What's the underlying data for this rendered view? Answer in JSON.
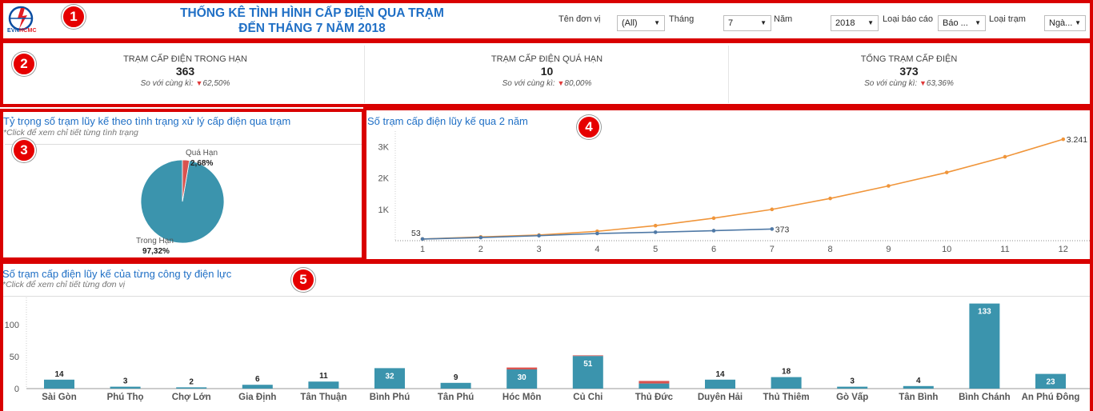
{
  "header": {
    "logo_text_a": "EVN",
    "logo_text_b": "HCMC",
    "title_line1": "THỐNG KÊ TÌNH HÌNH CẤP ĐIỆN QUA TRẠM",
    "title_line2": "ĐẾN THÁNG 7 NĂM 2018",
    "filters": [
      {
        "label": "Tên đơn vị",
        "value": "(All)"
      },
      {
        "label": "Tháng",
        "value": "7"
      },
      {
        "label": "Năm",
        "value": "2018"
      },
      {
        "label": "Loại báo cáo",
        "value": "Báo ..."
      },
      {
        "label": "Loại trạm",
        "value": "Ngà..."
      }
    ],
    "dropdown_arrow": "▼"
  },
  "badges": [
    "1",
    "2",
    "3",
    "4",
    "5"
  ],
  "kpis": [
    {
      "title": "Trạm cấp điện trong hạn",
      "value": "363",
      "compare_label": "So với cùng kì:",
      "compare_value": "62,50%"
    },
    {
      "title": "Trạm cấp điện quá hạn",
      "value": "10",
      "compare_label": "So với cùng kì:",
      "compare_value": "80,00%"
    },
    {
      "title": "Tổng trạm cấp điện",
      "value": "373",
      "compare_label": "So với cùng kì:",
      "compare_value": "63,36%"
    }
  ],
  "pie_section": {
    "title": "Tỷ trọng số trạm lũy kế theo tình trạng xử lý cấp điện qua trạm",
    "subtitle": "*Click để xem chỉ tiết từng tình trạng"
  },
  "line_section": {
    "title": "Số trạm cấp điện lũy kế qua 2 năm"
  },
  "bar_section": {
    "title": "Số trạm cấp điện lũy kế của từng công ty điện lực",
    "subtitle": "*Click để xem chỉ tiết từng đơn vị"
  },
  "colors": {
    "teal": "#3b94ad",
    "red": "#d9534f",
    "orange": "#f0953a",
    "blue_line": "#4f79a6",
    "title_blue": "#1f6fc5",
    "frame_red": "#d90000"
  },
  "chart_data": [
    {
      "type": "pie",
      "slices": [
        {
          "label": "Trong Hạn",
          "value": 97.32,
          "label_text": "97,32%"
        },
        {
          "label": "Quá Hạn",
          "value": 2.68,
          "label_text": "2,68%"
        }
      ]
    },
    {
      "type": "line",
      "x": [
        1,
        2,
        3,
        4,
        5,
        6,
        7,
        8,
        9,
        10,
        11,
        12
      ],
      "ylim": [
        0,
        3500
      ],
      "y_ticks": [
        "1K",
        "2K",
        "3K"
      ],
      "y_tick_values": [
        1000,
        2000,
        3000
      ],
      "series": [
        {
          "values": [
            53,
            120,
            180,
            300,
            480,
            720,
            1000,
            1350,
            1750,
            2180,
            2680,
            3241
          ],
          "color": "orange"
        },
        {
          "values": [
            53,
            100,
            160,
            230,
            270,
            320,
            373
          ],
          "color": "blue_line"
        }
      ],
      "point_labels": [
        {
          "series": 0,
          "index": 0,
          "text": "53"
        },
        {
          "series": 1,
          "index": 6,
          "text": "373"
        },
        {
          "series": 0,
          "index": 11,
          "text": "3.241"
        }
      ]
    },
    {
      "type": "bar",
      "categories": [
        "Sài Gòn",
        "Phú Thọ",
        "Chợ Lớn",
        "Gia Định",
        "Tân Thuận",
        "Bình Phú",
        "Tân Phú",
        "Hóc Môn",
        "Củ Chi",
        "Thủ Đức",
        "Duyên Hải",
        "Thủ Thiêm",
        "Gò Vấp",
        "Tân Bình",
        "Bình Chánh",
        "An Phú Đông"
      ],
      "y_ticks": [
        0,
        50,
        100
      ],
      "ylim": [
        0,
        140
      ],
      "series": [
        {
          "name": "Trong Hạn",
          "color": "teal",
          "values": [
            14,
            3,
            2,
            6,
            11,
            32,
            9,
            30,
            51,
            8,
            14,
            18,
            3,
            4,
            133,
            23
          ]
        },
        {
          "name": "Quá Hạn",
          "color": "red",
          "values": [
            0,
            0,
            0,
            0,
            0,
            0,
            0,
            3,
            1,
            4,
            0,
            0,
            0,
            0,
            0,
            0
          ]
        }
      ],
      "labels": [
        "14",
        "3",
        "2",
        "6",
        "11",
        "32",
        "9",
        "30",
        "51",
        "",
        "14",
        "18",
        "3",
        "4",
        "133",
        "23"
      ]
    }
  ]
}
